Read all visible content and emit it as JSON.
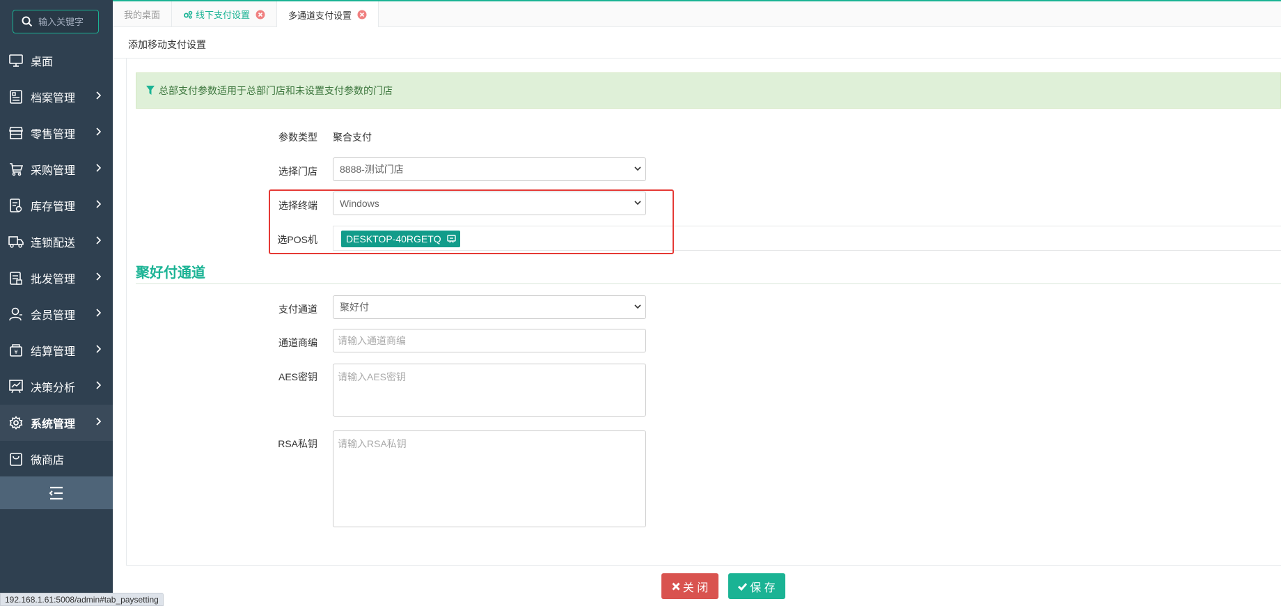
{
  "sidebar": {
    "search_placeholder": "输入关键字",
    "items": [
      {
        "label": "桌面",
        "icon": "monitor-icon",
        "has_arrow": false
      },
      {
        "label": "档案管理",
        "icon": "file-icon",
        "has_arrow": true
      },
      {
        "label": "零售管理",
        "icon": "store-icon",
        "has_arrow": true
      },
      {
        "label": "采购管理",
        "icon": "cart-icon",
        "has_arrow": true
      },
      {
        "label": "库存管理",
        "icon": "warehouse-icon",
        "has_arrow": true
      },
      {
        "label": "连锁配送",
        "icon": "truck-icon",
        "has_arrow": true
      },
      {
        "label": "批发管理",
        "icon": "clipboard-icon",
        "has_arrow": true
      },
      {
        "label": "会员管理",
        "icon": "user-icon",
        "has_arrow": true
      },
      {
        "label": "结算管理",
        "icon": "settlement-icon",
        "has_arrow": true
      },
      {
        "label": "决策分析",
        "icon": "chart-icon",
        "has_arrow": true
      },
      {
        "label": "系统管理",
        "icon": "gear-icon",
        "has_arrow": true,
        "active": true
      },
      {
        "label": "微商店",
        "icon": "bag-icon",
        "has_arrow": false
      }
    ],
    "collapse_icon": "menu-collapse-icon"
  },
  "tabs": [
    {
      "label": "我的桌面",
      "closable": false
    },
    {
      "label": "线下支付设置",
      "closable": true,
      "icon": "cogs-icon"
    },
    {
      "label": "多通道支付设置",
      "closable": true,
      "active": true
    }
  ],
  "page": {
    "title": "添加移动支付设置",
    "alert": "总部支付参数适用于总部门店和未设置支付参数的门店"
  },
  "form": {
    "param_type_label": "参数类型",
    "param_type_value": "聚合支付",
    "store_label": "选择门店",
    "store_value": "8888-测试门店",
    "terminal_label": "选择终端",
    "terminal_value": "Windows",
    "pos_label": "选POS机",
    "pos_chip": "DESKTOP-40RGETQ"
  },
  "section": {
    "title": "聚好付通道",
    "channel_label": "支付通道",
    "channel_value": "聚好付",
    "merchant_label": "通道商编",
    "merchant_placeholder": "请输入通道商编",
    "aes_label": "AES密钥",
    "aes_placeholder": "请输入AES密钥",
    "rsa_label": "RSA私钥",
    "rsa_placeholder": "请输入RSA私钥"
  },
  "buttons": {
    "close": "关 闭",
    "save": "保 存"
  },
  "status_url": "192.168.1.61:5008/admin#tab_paysetting",
  "colors": {
    "accent": "#1ab394",
    "sidebar": "#2f4050",
    "danger": "#d9534f",
    "highlight": "#e53935"
  }
}
